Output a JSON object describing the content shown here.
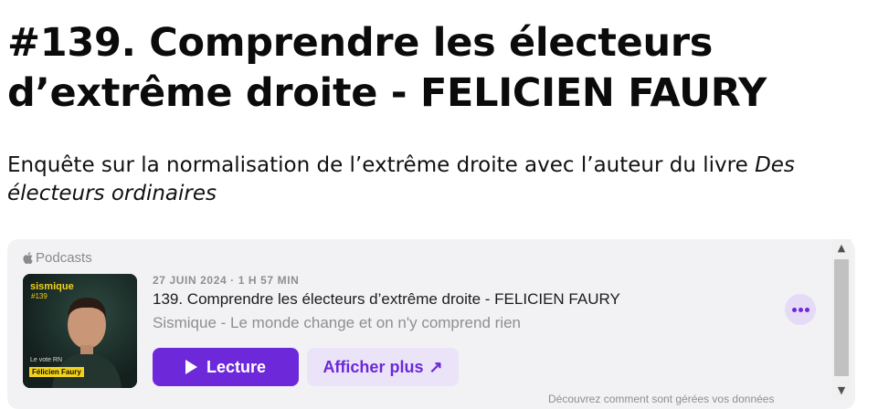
{
  "article": {
    "title": "#139. Comprendre les électeurs d’extrême droite - FELICIEN FAURY",
    "subtitle_plain": "Enquête sur la normalisation de l’extrême droite avec l’auteur du livre ",
    "subtitle_italic": "Des électeurs ordinaires"
  },
  "embed": {
    "brand": "Podcasts",
    "meta": "27 JUIN 2024 · 1 H 57 MIN",
    "episode_title": "139. Comprendre les électeurs d’extrême droite - FELICIEN FAURY",
    "show_name": "Sismique - Le monde change et on n'y comprend rien",
    "play_label": "Lecture",
    "more_label": "Afficher plus",
    "privacy_text": "Découvrez comment sont gérées vos données",
    "artwork": {
      "brand": "sismique",
      "number": "#139",
      "caption": "Le vote RN",
      "name": "Félicien Faury"
    },
    "colors": {
      "accent": "#6d28d9",
      "accent_soft": "#ebe4f9",
      "background": "#f2f2f4"
    }
  },
  "icons": {
    "brand": "apple-icon",
    "play": "play-icon",
    "external": "arrow-up-right-icon",
    "more": "ellipsis-icon"
  }
}
